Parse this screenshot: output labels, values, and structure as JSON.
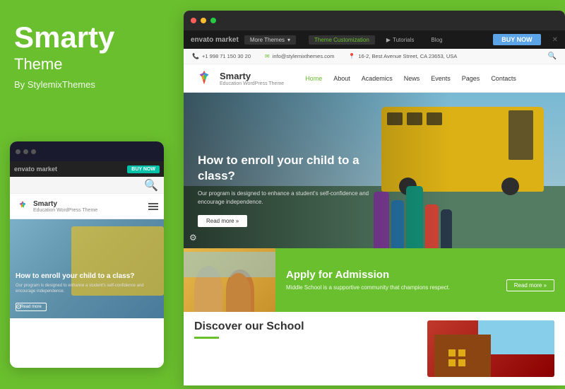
{
  "background_color": "#6abf2e",
  "left_panel": {
    "title": "Smarty",
    "subtitle": "Theme",
    "author": "By StylemixThemes"
  },
  "mobile_mockup": {
    "dots": [
      "gray",
      "gray",
      "gray"
    ],
    "envato_bar": {
      "logo": "envato market",
      "buy_now": "BUY NOW"
    },
    "brand": {
      "name": "Smarty",
      "tagline": "Education WordPress Theme"
    },
    "hero": {
      "title": "How to enroll your child to a class?",
      "description": "Our program is designed to enhance a student's self-confidence and encourage independence.",
      "read_more": "Read more"
    }
  },
  "desktop_mockup": {
    "window_dots": [
      "red",
      "yellow",
      "green"
    ],
    "envato_bar": {
      "logo": "envato market",
      "more_themes": "More Themes",
      "theme_customization": "Theme Customization",
      "tutorials": "Tutorials",
      "blog": "Blog",
      "buy_now": "BUY NOW"
    },
    "contact_bar": {
      "phone": "+1 998 71 150 30 20",
      "email": "info@stylemixthemes.com",
      "address": "16-2, Best Avenue Street, CA 23653, USA"
    },
    "nav": {
      "brand_name": "Smarty",
      "brand_tagline": "Education WordPress Theme",
      "items": [
        "Home",
        "About",
        "Academics",
        "News",
        "Events",
        "Pages",
        "Contacts"
      ]
    },
    "hero": {
      "title": "How to enroll your child to a class?",
      "description": "Our program is designed to enhance a student's self-confidence and encourage independence.",
      "read_more": "Read more »"
    },
    "admission": {
      "title": "Apply for Admission",
      "description": "Middle School is a supportive community that champions respect.",
      "read_more": "Read more »"
    },
    "discover": {
      "title": "Discover our School"
    }
  }
}
